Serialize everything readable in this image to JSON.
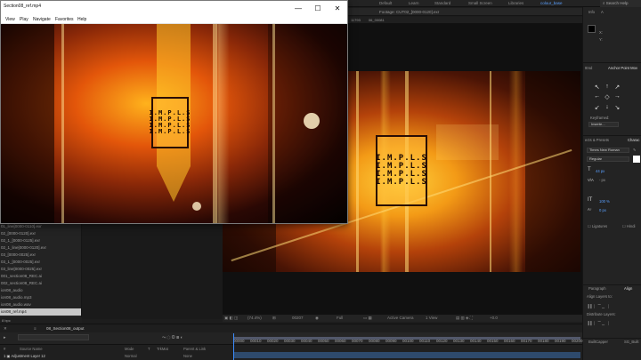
{
  "ae": {
    "topbar": {
      "items": [
        "Default",
        "Learn",
        "Standard",
        "Small Screen",
        "Libraries"
      ],
      "workspace_active": "colour_base",
      "search_placeholder": "Search Help"
    },
    "footage": {
      "tab_label": "Footage: CUT02_[0000-0120].exr",
      "sub_left": "11793",
      "sub_mid": "06_00081"
    },
    "viewer_controls": {
      "zoom": "(74.4%)",
      "timecode": "00207",
      "resolution": "Full",
      "camera": "Active Camera",
      "view": "1 View",
      "offset": "+0.0"
    },
    "preview": {
      "impls_lines": [
        "I.M.P.L.S",
        "I.M.P.L.S",
        "I.M.P.L.S",
        "I.M.P.L.S"
      ]
    },
    "right_panel": {
      "tabs_top": [
        "Info",
        "A"
      ],
      "xy": [
        "X:",
        "Y:"
      ],
      "effects_tab": "tEsd",
      "anchor_tab": "Anchor Point Mov",
      "keyframed_label": "Keyframed:",
      "keyframed_value": "Inserte...",
      "effects_presets": "ects & Presets",
      "character_tab": "Charac",
      "font": "Times New Roman",
      "style": "Regular",
      "size": "44 px",
      "tracking": "- px",
      "vscale": "100 %",
      "baseline": "0 px",
      "ligatures": "Ligatures",
      "hindi": "Hindi",
      "paragraph_tab": "Paragraph",
      "align_tab": "Align",
      "align_layers_to": "Align Layers to:",
      "distribute_layers": "Distribute Layers:",
      "bottom_tabs": [
        "BuiltCapper",
        "SG_Built"
      ]
    },
    "project_items": [
      "01_line[0000-0110].exr",
      "02_[0000-0120].exr",
      "02_1_[0000-0125].exr",
      "02_1_line[0000-0120].exr",
      "03_[0000-0025].exr",
      "03_1_[0000-0025].exr",
      "03_line[0000-0025].exr",
      "001_section08_REC.ai",
      "002_section08_REC.ai",
      "ion08_audio",
      "ion08_audio.mp3",
      "ion08_audio.wav",
      "ion08_ref.mp4"
    ],
    "project_selected_index": 12,
    "project_footer": "8 bpc",
    "timeline": {
      "tab_label": "08_Section08_output",
      "col_headers": [
        "#",
        "Source Name",
        "Mode",
        "T",
        "TrkMat",
        "Parent & Link"
      ],
      "layer_name": "Adjustment Layer 12",
      "layer_mode": "Normal",
      "layer_parent": "None",
      "ruler_ticks": [
        "00000",
        "00010",
        "00020",
        "00030",
        "00040",
        "00050",
        "00060",
        "00070",
        "00080",
        "00090",
        "00100",
        "00110",
        "00120",
        "00130",
        "00140",
        "00150",
        "00160",
        "00170",
        "00180",
        "00190",
        "00200"
      ]
    }
  },
  "player": {
    "title": "Section08_ref.mp4",
    "menu": [
      "View",
      "Play",
      "Navigate",
      "Favorites",
      "Help"
    ],
    "video_impls_lines": [
      "I.M.P.L.S",
      "I.M.P.L.S",
      "I.M.P.L.S",
      "I.M.P.L.S"
    ],
    "buttons": {
      "minimize": "—",
      "maximize": "☐",
      "close": "✕"
    }
  },
  "colors": {
    "ae_bg": "#1d1d1d",
    "accent_blue": "#3c8dff",
    "orange": "#f39a16"
  }
}
